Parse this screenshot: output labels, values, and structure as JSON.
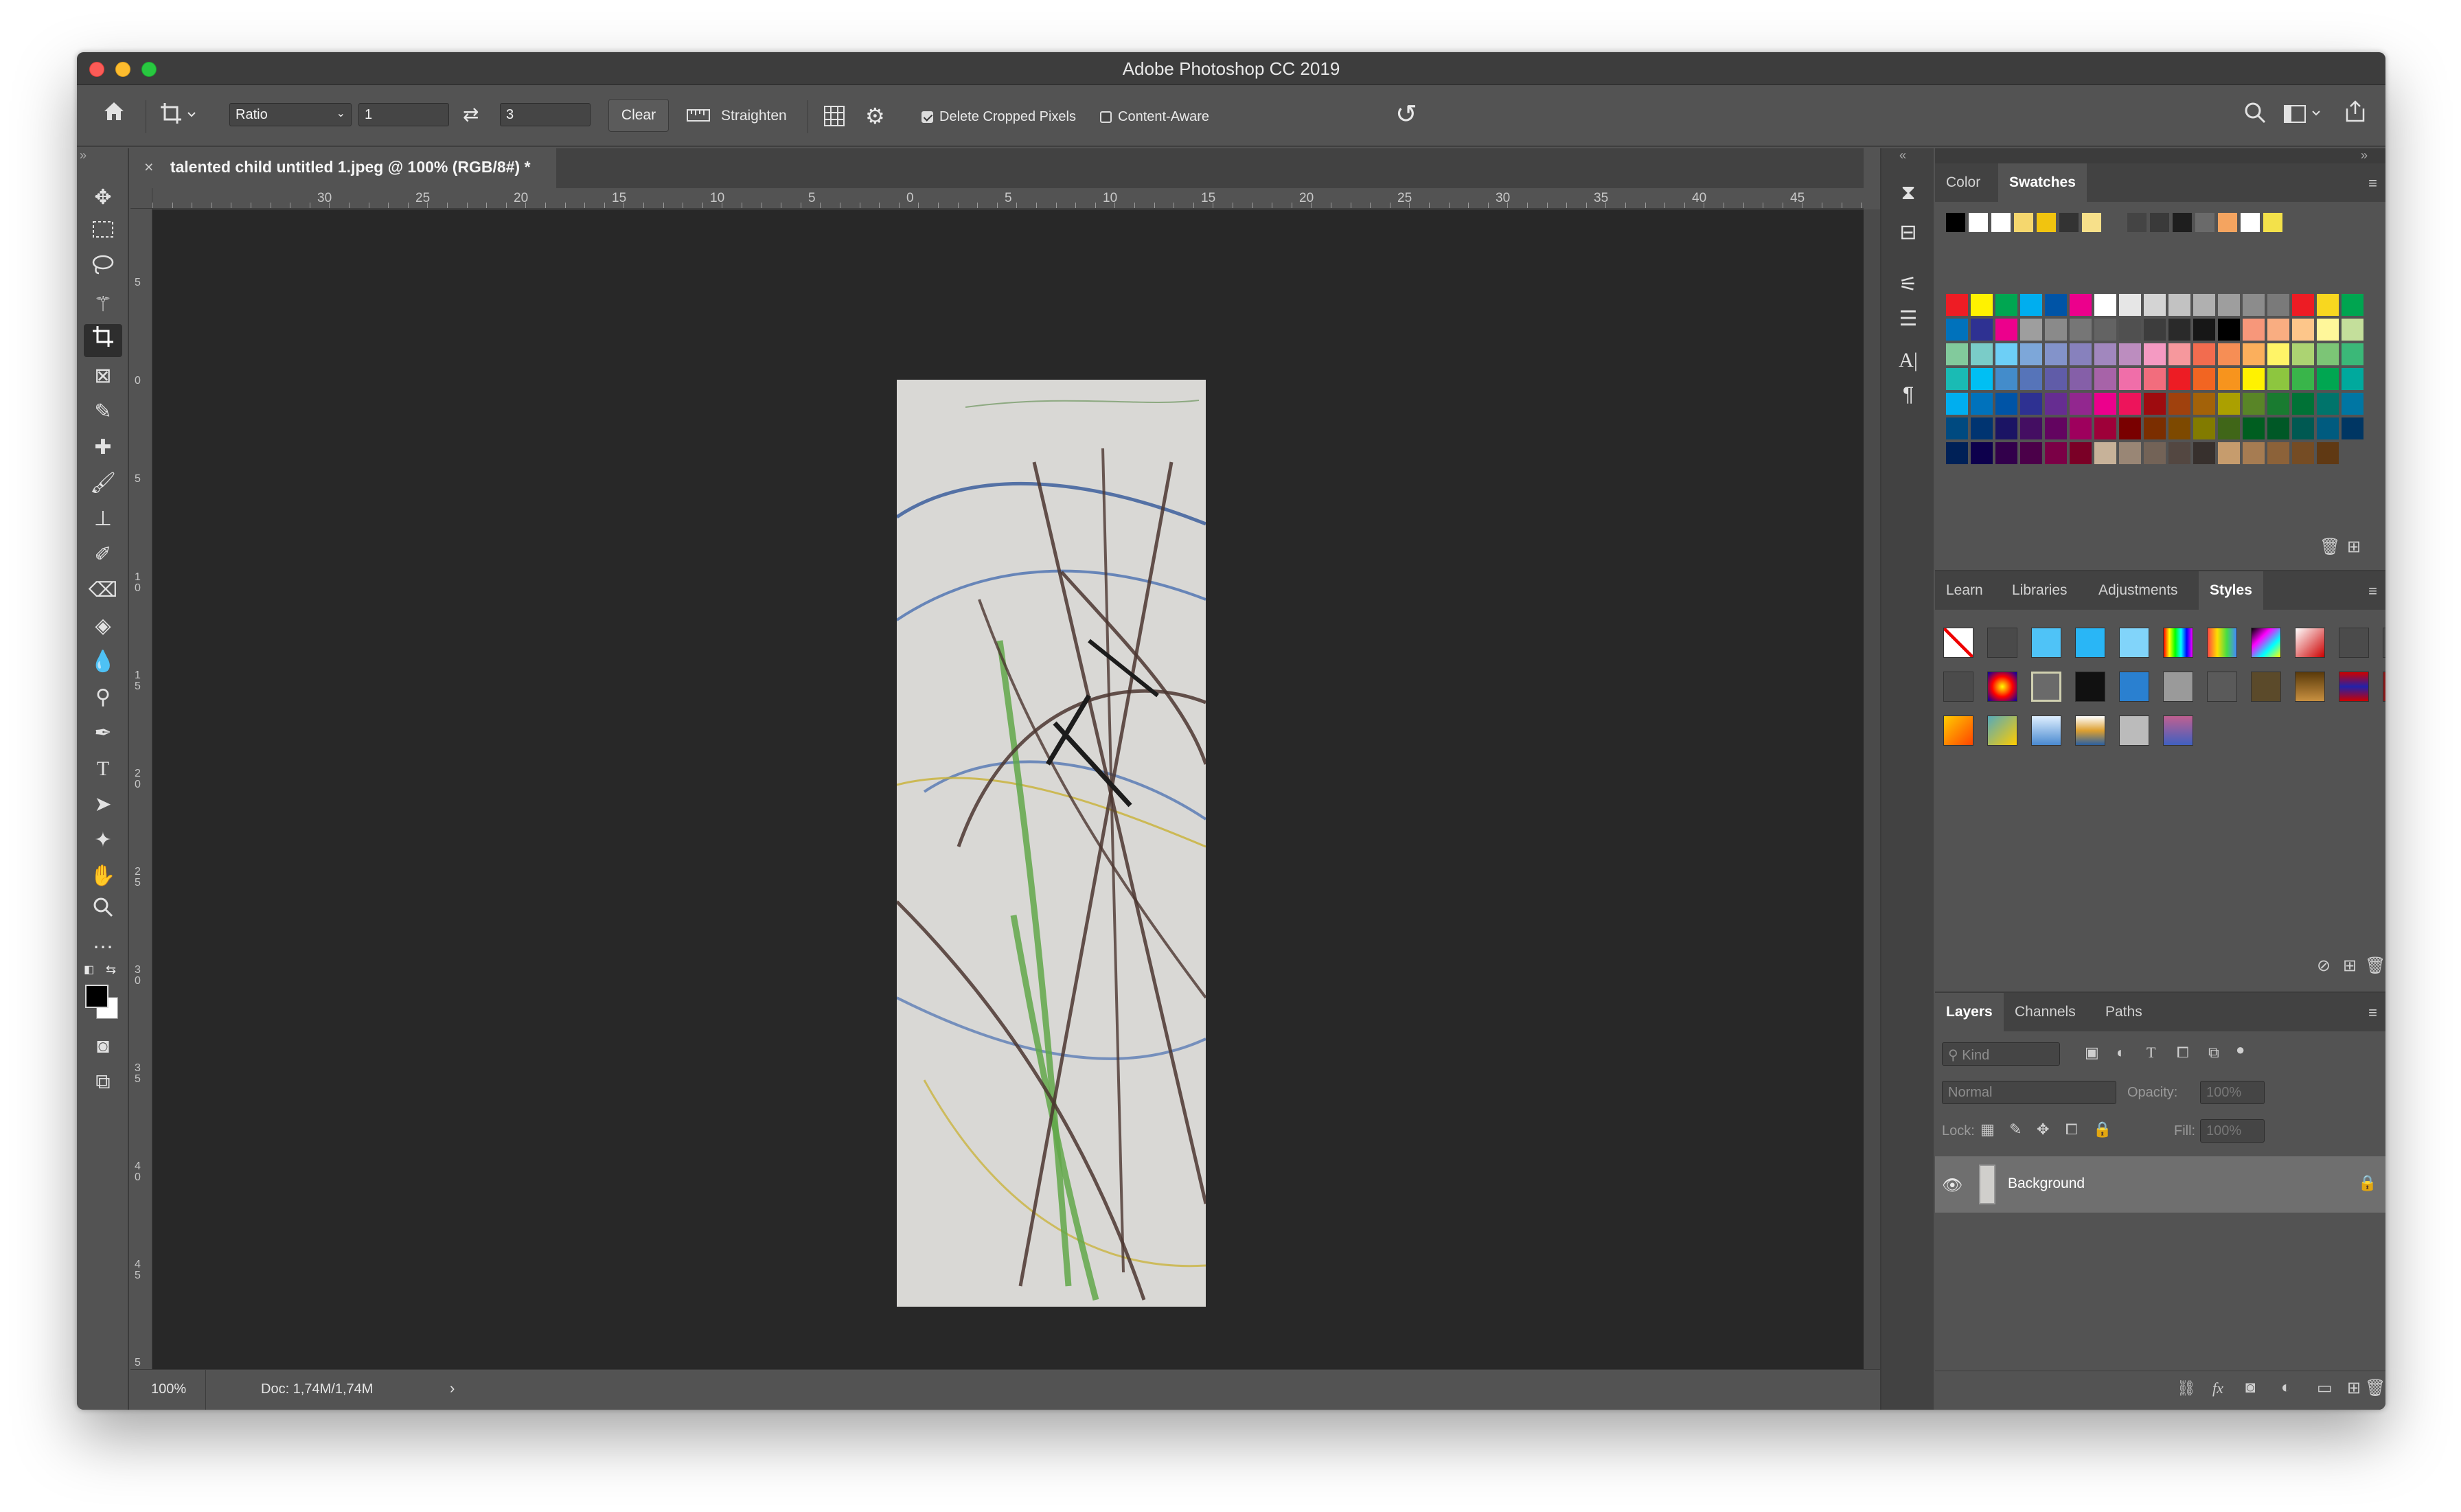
{
  "window": {
    "title": "Adobe Photoshop CC 2019"
  },
  "options_bar": {
    "ratio_select": "Ratio",
    "ratio_w": "1",
    "ratio_h": "3",
    "clear_label": "Clear",
    "straighten_label": "Straighten",
    "delete_cropped_label": "Delete Cropped Pixels",
    "delete_cropped_checked": true,
    "content_aware_label": "Content-Aware",
    "content_aware_checked": false
  },
  "document": {
    "tab_title": "talented child untitled 1.jpeg @ 100% (RGB/8#) *",
    "zoom": "100%",
    "doc_size": "Doc: 1,74M/1,74M"
  },
  "rulers": {
    "h_labels": [
      "30",
      "25",
      "20",
      "15",
      "10",
      "5",
      "0",
      "5",
      "10",
      "15",
      "20",
      "25",
      "30",
      "35",
      "40",
      "45"
    ],
    "v_labels": [
      "5",
      "0",
      "5",
      "1\n0",
      "1\n5",
      "2\n0",
      "2\n5",
      "3\n0",
      "3\n5",
      "4\n0",
      "4\n5",
      "5\n0"
    ]
  },
  "color_panel": {
    "tabs": [
      "Color",
      "Swatches"
    ],
    "active_tab": "Swatches",
    "recent_swatches": [
      "#000000",
      "#ffffff",
      "#ffffff",
      "#f5d76e",
      "#f1c40f",
      "#333333",
      "#f7e08a",
      "#535353",
      "#444444",
      "#3a3a3a",
      "#1e1e1e",
      "#6a6a6a",
      "#f4a460",
      "#ffffff",
      "#f3e14a"
    ],
    "swatch_rows": [
      [
        "#ee1c24",
        "#fff200",
        "#00a651",
        "#00aeef",
        "#0054a6",
        "#ec008c",
        "#ffffff",
        "#e6e6e6",
        "#d4d4d4",
        "#c2c2c2",
        "#b0b0b0",
        "#9e9e9e",
        "#8c8c8c",
        "#7a7a7a",
        "#ed1c24",
        "#f8d71f",
        "#00a550"
      ],
      [
        "#0072bc",
        "#2e3192",
        "#ec008c",
        "#9e9e9e",
        "#8a8a8a",
        "#767676",
        "#636363",
        "#505050",
        "#3d3d3d",
        "#2a2a2a",
        "#171717",
        "#000000",
        "#f7977a",
        "#f9ad81",
        "#fdc68a",
        "#fff79a",
        "#c4df9b"
      ],
      [
        "#82ca9c",
        "#7accc8",
        "#6dcff6",
        "#7da7d9",
        "#8393ca",
        "#8781bd",
        "#a187be",
        "#bc8dbf",
        "#f49ac2",
        "#f6989d",
        "#f26c4f",
        "#f68e55",
        "#fbaf5c",
        "#fff467",
        "#acd372",
        "#7cc576",
        "#3bb878"
      ],
      [
        "#1abbb4",
        "#00bff3",
        "#438ccb",
        "#5674b9",
        "#605ca8",
        "#855fa8",
        "#a763a8",
        "#f06ea9",
        "#f26d7d",
        "#ed1c24",
        "#f26522",
        "#f7941d",
        "#fff200",
        "#8dc63f",
        "#39b54a",
        "#00a651",
        "#00a99d"
      ],
      [
        "#00aeef",
        "#0072bc",
        "#0054a6",
        "#2e3192",
        "#662d91",
        "#92278f",
        "#ec008c",
        "#ed145b",
        "#9e0b0f",
        "#a0410d",
        "#a36209",
        "#aba000",
        "#598527",
        "#197b30",
        "#007236",
        "#00746b",
        "#0076a3"
      ],
      [
        "#004a80",
        "#003471",
        "#1b1464",
        "#440e62",
        "#630460",
        "#9e005d",
        "#9e0039",
        "#790000",
        "#7b2e00",
        "#7d4900",
        "#827b00",
        "#406618",
        "#005e20",
        "#005826",
        "#005952",
        "#005b7f",
        "#003663"
      ],
      [
        "#002157",
        "#0d004c",
        "#32004b",
        "#4b0049",
        "#7b0046",
        "#7a0026",
        "#c7b299",
        "#998675",
        "#736357",
        "#534741",
        "#37302d",
        "#c69c6d",
        "#a67c52",
        "#8c6239",
        "#754c24",
        "#603913"
      ]
    ]
  },
  "styles_panel": {
    "tabs": [
      "Learn",
      "Libraries",
      "Adjustments",
      "Styles"
    ],
    "active_tab": "Styles"
  },
  "layers_panel": {
    "tabs": [
      "Layers",
      "Channels",
      "Paths"
    ],
    "active_tab": "Layers",
    "kind_label": "Kind",
    "blend_mode": "Normal",
    "opacity_label": "Opacity:",
    "opacity_value": "100%",
    "lock_label": "Lock:",
    "fill_label": "Fill:",
    "fill_value": "100%",
    "layers": [
      {
        "name": "Background",
        "visible": true,
        "locked": true
      }
    ]
  }
}
